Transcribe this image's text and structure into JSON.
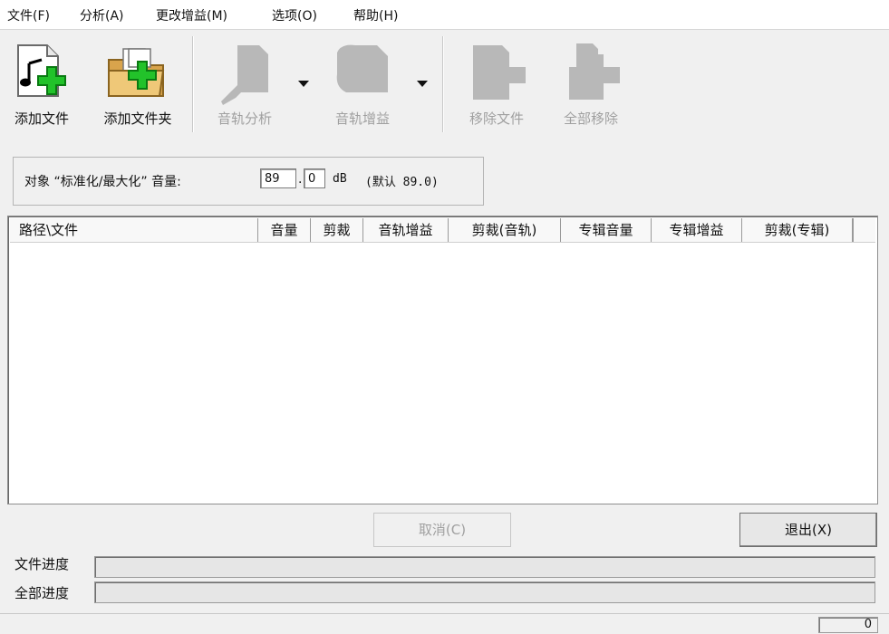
{
  "menu": [
    "文件(F)",
    "分析(A)",
    "更改增益(M)",
    "选项(O)",
    "帮助(H)"
  ],
  "toolbar": {
    "add_file": "添加文件",
    "add_folder": "添加文件夹",
    "track_analysis": "音轨分析",
    "track_gain": "音轨增益",
    "remove_file": "移除文件",
    "remove_all": "全部移除"
  },
  "target": {
    "label": "对象 “标准化/最大化” 音量:",
    "integer": "89",
    "decimal": "0",
    "unit": "dB",
    "default_text": "(默认 89.0)"
  },
  "list": {
    "columns": [
      "路径\\文件",
      "音量",
      "剪裁",
      "音轨增益",
      "剪裁(音轨)",
      "专辑音量",
      "专辑增益",
      "剪裁(专辑)"
    ],
    "rows": []
  },
  "buttons": {
    "cancel": "取消(C)",
    "exit": "退出(X)"
  },
  "progress": {
    "file_label": "文件进度",
    "file_value": 0,
    "all_label": "全部进度",
    "all_value": 0
  },
  "status": {
    "count": "0"
  }
}
